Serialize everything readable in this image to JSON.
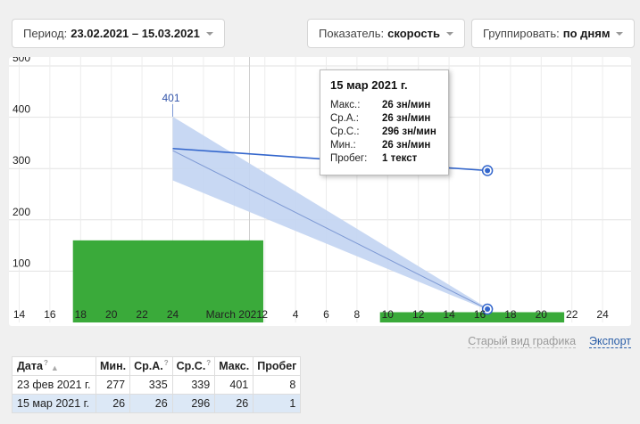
{
  "controls": {
    "period": {
      "label": "Период:",
      "value": "23.02.2021 – 15.03.2021"
    },
    "metric": {
      "label": "Показатель:",
      "value": "скорость"
    },
    "group": {
      "label": "Группировать:",
      "value": "по дням"
    }
  },
  "chart_data": {
    "type": "line",
    "y_ticks": [
      "500",
      "400",
      "300",
      "200",
      "100"
    ],
    "ylim": [
      0,
      500
    ],
    "x_labels": [
      {
        "day": 14,
        "text": "14"
      },
      {
        "day": 16,
        "text": "16"
      },
      {
        "day": 18,
        "text": "18"
      },
      {
        "day": 20,
        "text": "20"
      },
      {
        "day": 22,
        "text": "22"
      },
      {
        "day": 24,
        "text": "24"
      },
      {
        "day": 28,
        "text": "March 2021"
      },
      {
        "day": 30,
        "text": "2"
      },
      {
        "day": 32,
        "text": "4"
      },
      {
        "day": 34,
        "text": "6"
      },
      {
        "day": 36,
        "text": "8"
      },
      {
        "day": 38,
        "text": "10"
      },
      {
        "day": 40,
        "text": "12"
      },
      {
        "day": 42,
        "text": "14"
      },
      {
        "day": 44,
        "text": "16"
      },
      {
        "day": 46,
        "text": "18"
      },
      {
        "day": 48,
        "text": "20"
      },
      {
        "day": 50,
        "text": "22"
      },
      {
        "day": 52,
        "text": "24"
      }
    ],
    "bars": [
      {
        "start": 17.5,
        "end": 29.9,
        "value": 8
      },
      {
        "start": 37.5,
        "end": 49.5,
        "value": 1
      }
    ],
    "bar_max": 8,
    "bar_height_value": 160,
    "avg_line": [
      {
        "day": 24.0,
        "value": 339
      },
      {
        "day": 44.5,
        "value": 296
      }
    ],
    "band": [
      {
        "day": 24.0,
        "min": 277,
        "avg": 335,
        "max": 401
      },
      {
        "day": 44.5,
        "min": 26,
        "avg": 26,
        "max": 26
      }
    ],
    "peak_label": {
      "day": 24.0,
      "value": 401,
      "text": "401"
    },
    "highlight_point": {
      "day": 44.5,
      "value": 296
    },
    "colors": {
      "bar": "#3aaa3a",
      "line": "#3366cc",
      "band": "#c2d4f2"
    }
  },
  "tooltip": {
    "title": "15 мар 2021 г.",
    "rows": [
      {
        "k": "Макс.:",
        "v": "26 зн/мин"
      },
      {
        "k": "Ср.А.:",
        "v": "26 зн/мин"
      },
      {
        "k": "Ср.С.:",
        "v": "296 зн/мин"
      },
      {
        "k": "Мин.:",
        "v": "26 зн/мин"
      },
      {
        "k": "Пробег:",
        "v": "1 текст"
      }
    ]
  },
  "links": {
    "old_view": "Старый вид графика",
    "export": "Экспорт"
  },
  "table": {
    "headers": [
      "Дата",
      "Мин.",
      "Ср.А.",
      "Ср.С.",
      "Макс.",
      "Пробег"
    ],
    "help_mark": "?",
    "sort_mark": "▲",
    "rows": [
      [
        "23 фев 2021 г.",
        "277",
        "335",
        "339",
        "401",
        "8"
      ],
      [
        "15 мар 2021 г.",
        "26",
        "26",
        "296",
        "26",
        "1"
      ]
    ]
  }
}
